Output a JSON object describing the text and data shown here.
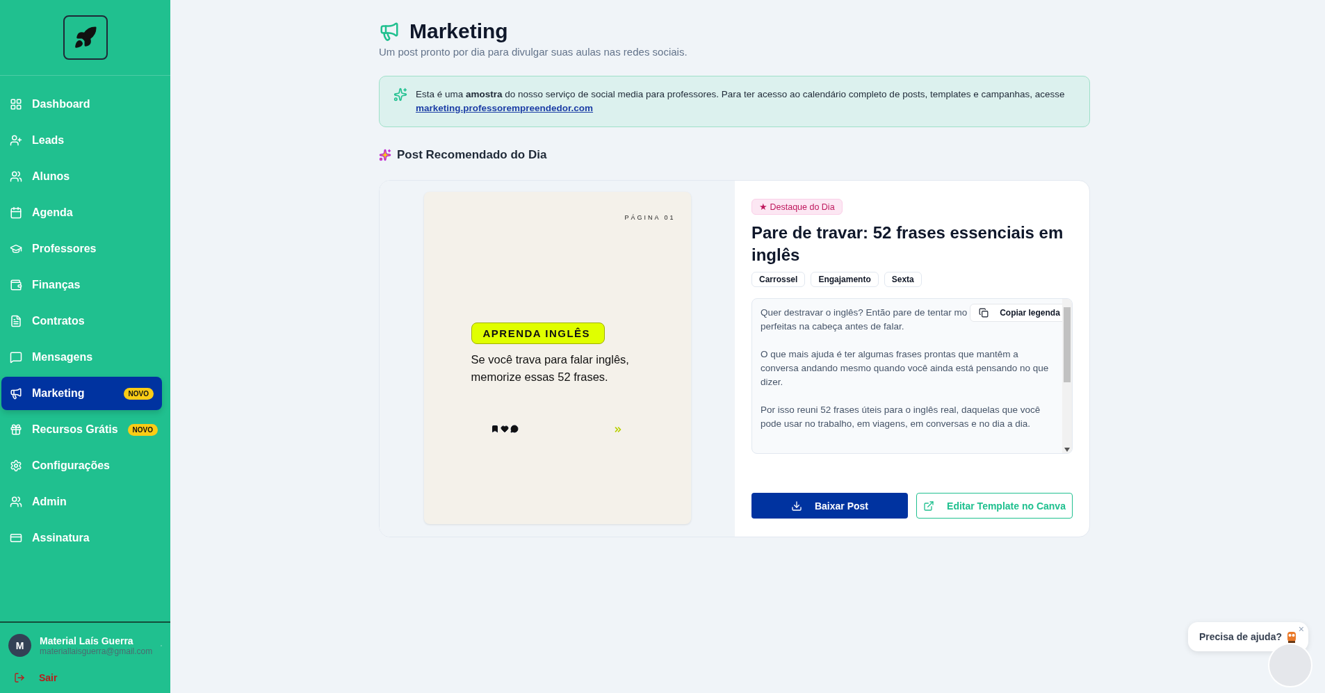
{
  "sidebar": {
    "items": [
      {
        "label": "Dashboard",
        "selected": false
      },
      {
        "label": "Leads",
        "selected": false
      },
      {
        "label": "Alunos",
        "selected": false
      },
      {
        "label": "Agenda",
        "selected": false
      },
      {
        "label": "Professores",
        "selected": false
      },
      {
        "label": "Finanças",
        "selected": false
      },
      {
        "label": "Contratos",
        "selected": false
      },
      {
        "label": "Mensagens",
        "selected": false
      },
      {
        "label": "Marketing",
        "selected": true,
        "badge": "NOVO"
      },
      {
        "label": "Recursos Grátis",
        "selected": false,
        "badge": "NOVO"
      },
      {
        "label": "Configurações",
        "selected": false
      },
      {
        "label": "Admin",
        "selected": false
      },
      {
        "label": "Assinatura",
        "selected": false
      }
    ],
    "user": {
      "initial": "M",
      "name": "Material Laís Guerra",
      "email": "materiallaisguerra@gmail.com"
    },
    "logout": "Sair"
  },
  "header": {
    "title": "Marketing",
    "subtitle": "Um post pronto por dia para divulgar suas aulas nas redes sociais."
  },
  "notice": {
    "text": "Esta é uma **amostra** do nosso serviço de social media para professores. Para ter acesso ao calendário completo de posts, templates e campanhas, acesse",
    "link": "marketing.professorempreendedor.com"
  },
  "section_title": "Post Recomendado do Dia",
  "post": {
    "preview": {
      "page": "PÁGINA 01",
      "tag": "APRENDA INGLÊS",
      "text": "Se você trava para falar inglês, memorize essas 52 frases."
    },
    "badge": "★ Destaque do Dia",
    "title": "Pare de travar: 52 frases essenciais em inglês",
    "tags": [
      "Carrossel",
      "Engajamento",
      "Sexta"
    ],
    "copy_button": "Copiar legenda",
    "caption": [
      "Quer destravar o inglês? Então pare de tentar mo",
      "perfeitas na cabeça antes de falar.",
      "O que mais ajuda é ter algumas frases prontas que mantêm a conversa andando mesmo quando você ainda está pensando no que dizer.",
      "Por isso reuni 52 frases úteis para o inglês real, daquelas que você pode usar no trabalho, em viagens, em conversas e no dia a dia."
    ],
    "buttons": [
      {
        "kind": "primary",
        "label": "Baixar Post"
      },
      {
        "kind": "outline",
        "label": "Editar Template no Canva"
      }
    ]
  },
  "help": {
    "text": "Precisa de ajuda?",
    "close": "×"
  }
}
